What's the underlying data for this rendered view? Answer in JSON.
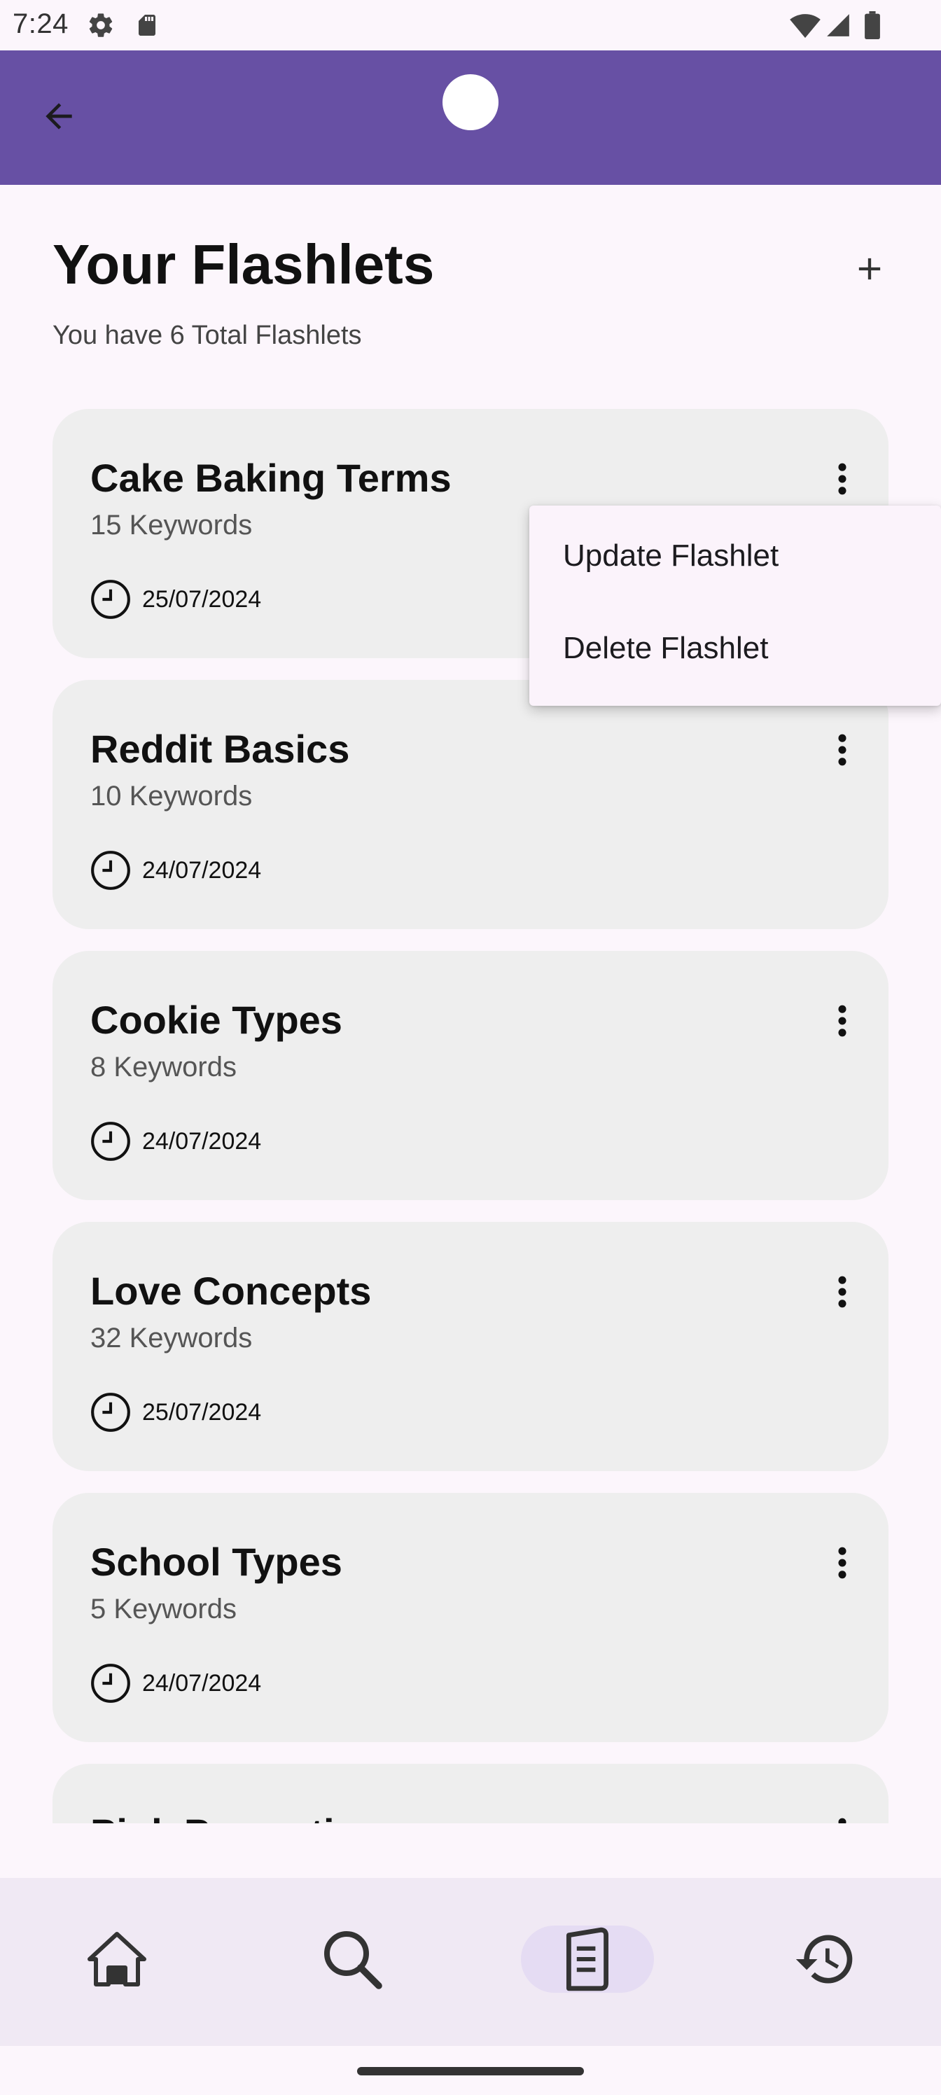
{
  "status_bar": {
    "time": "7:24",
    "icons": [
      "settings-icon",
      "sd-card-icon",
      "wifi-icon",
      "signal-icon",
      "battery-icon"
    ]
  },
  "app_bar": {
    "color": "#6750a4",
    "back_icon": "arrow-back-icon"
  },
  "header": {
    "title": "Your Flashlets",
    "subtitle": "You have 6 Total Flashlets",
    "add_icon": "plus-icon"
  },
  "flashlets": [
    {
      "title": "Cake Baking Terms",
      "keywords": "15 Keywords",
      "date": "25/07/2024"
    },
    {
      "title": "Reddit Basics",
      "keywords": "10 Keywords",
      "date": "24/07/2024"
    },
    {
      "title": "Cookie Types",
      "keywords": "8 Keywords",
      "date": "24/07/2024"
    },
    {
      "title": "Love Concepts",
      "keywords": "32 Keywords",
      "date": "25/07/2024"
    },
    {
      "title": "School Types",
      "keywords": "5 Keywords",
      "date": "24/07/2024"
    },
    {
      "title": "Pink Properties",
      "keywords": "",
      "date": ""
    }
  ],
  "popup_menu": {
    "items": [
      {
        "label": "Update Flashlet"
      },
      {
        "label": "Delete Flashlet"
      }
    ]
  },
  "bottom_nav": {
    "items": [
      {
        "icon": "home-icon",
        "active": false
      },
      {
        "icon": "search-icon",
        "active": false
      },
      {
        "icon": "flashlets-icon",
        "active": true
      },
      {
        "icon": "history-icon",
        "active": false
      }
    ],
    "active_color": "#e5dcf3"
  }
}
